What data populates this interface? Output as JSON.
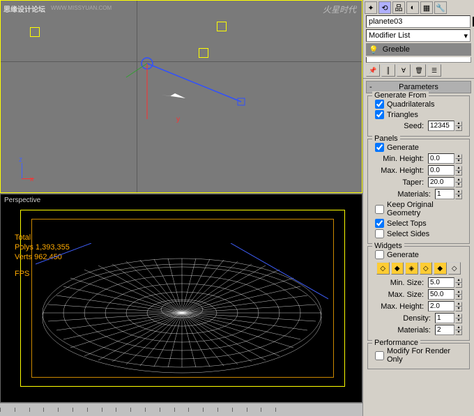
{
  "watermark": {
    "text": "思缘设计论坛",
    "url": "WWW.MISSYUAN.COM",
    "logo": "火星时代"
  },
  "viewportTop": {
    "yLabel": "y"
  },
  "viewportBottom": {
    "label": "Perspective",
    "stats": {
      "totalLabel": "Total",
      "polysLabel": "Polys",
      "polys": "1,393,355",
      "vertsLabel": "Verts",
      "verts": "962,450",
      "fpsLabel": "FPS"
    }
  },
  "panel": {
    "objectName": "planete03",
    "modifierListLabel": "Modifier List",
    "modifierName": "Greeble",
    "rollouts": {
      "parameters": "Parameters",
      "performance": "Performance"
    },
    "generateFrom": {
      "title": "Generate From",
      "quadrilaterals": "Quadrilaterals",
      "triangles": "Triangles",
      "seedLabel": "Seed:",
      "seedValue": "12345"
    },
    "panels": {
      "title": "Panels",
      "generate": "Generate",
      "minHeightLabel": "Min. Height:",
      "minHeight": "0.0",
      "maxHeightLabel": "Max. Height:",
      "maxHeight": "0.0",
      "taperLabel": "Taper:",
      "taper": "20.0",
      "materialsLabel": "Materials:",
      "materials": "1",
      "keepOriginal": "Keep Original Geometry",
      "selectTops": "Select Tops",
      "selectSides": "Select Sides"
    },
    "widgets": {
      "title": "Widgets",
      "generate": "Generate",
      "minSizeLabel": "Min. Size:",
      "minSize": "5.0",
      "maxSizeLabel": "Max. Size:",
      "maxSize": "50.0",
      "maxHeightLabel": "Max. Height:",
      "maxHeight": "2.0",
      "densityLabel": "Density:",
      "density": "1",
      "materialsLabel": "Materials:",
      "materials": "2"
    },
    "performance": {
      "modifyForRenderOnly": "Modify For Render Only"
    }
  }
}
